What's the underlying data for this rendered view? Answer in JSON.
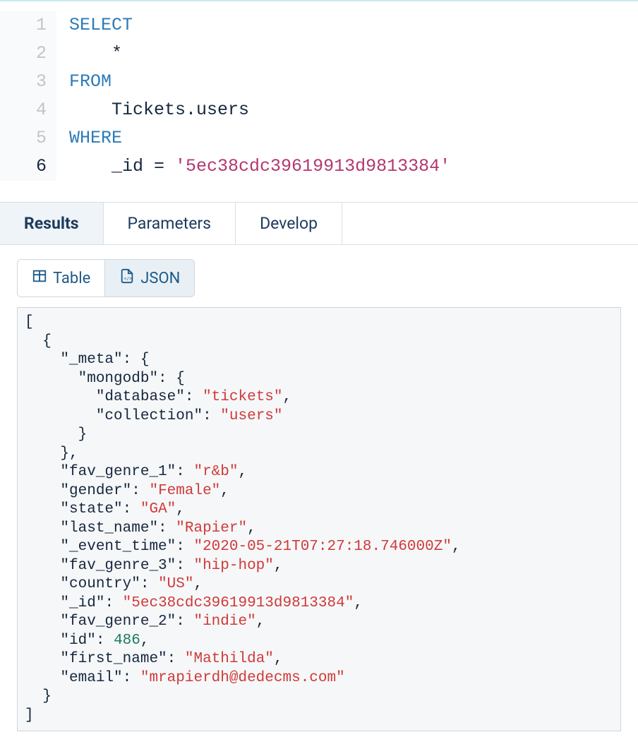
{
  "editor": {
    "lines": [
      {
        "n": "1",
        "tokens": [
          {
            "t": "SELECT",
            "cls": "kw"
          }
        ]
      },
      {
        "n": "2",
        "tokens": [
          {
            "t": "    *",
            "cls": ""
          }
        ]
      },
      {
        "n": "3",
        "tokens": [
          {
            "t": "FROM",
            "cls": "kw"
          }
        ]
      },
      {
        "n": "4",
        "tokens": [
          {
            "t": "    Tickets.users",
            "cls": ""
          }
        ]
      },
      {
        "n": "5",
        "tokens": [
          {
            "t": "WHERE",
            "cls": "kw"
          }
        ]
      },
      {
        "n": "6",
        "cursor": true,
        "tokens": [
          {
            "t": "    _id = ",
            "cls": ""
          },
          {
            "t": "'5ec38cdc39619913d9813384'",
            "cls": "str"
          }
        ]
      }
    ]
  },
  "tabs": {
    "items": [
      {
        "label": "Results",
        "active": true
      },
      {
        "label": "Parameters",
        "active": false
      },
      {
        "label": "Develop",
        "active": false
      }
    ]
  },
  "view_buttons": {
    "items": [
      {
        "label": "Table",
        "icon": "table-icon",
        "active": false
      },
      {
        "label": "JSON",
        "icon": "json-file-icon",
        "active": true
      }
    ]
  },
  "json_result": [
    {
      "_meta": {
        "mongodb": {
          "database": "tickets",
          "collection": "users"
        }
      },
      "fav_genre_1": "r&b",
      "gender": "Female",
      "state": "GA",
      "last_name": "Rapier",
      "_event_time": "2020-05-21T07:27:18.746000Z",
      "fav_genre_3": "hip-hop",
      "country": "US",
      "_id": "5ec38cdc39619913d9813384",
      "fav_genre_2": "indie",
      "id": 486,
      "first_name": "Mathilda",
      "email": "mrapierdh@dedecms.com"
    }
  ]
}
